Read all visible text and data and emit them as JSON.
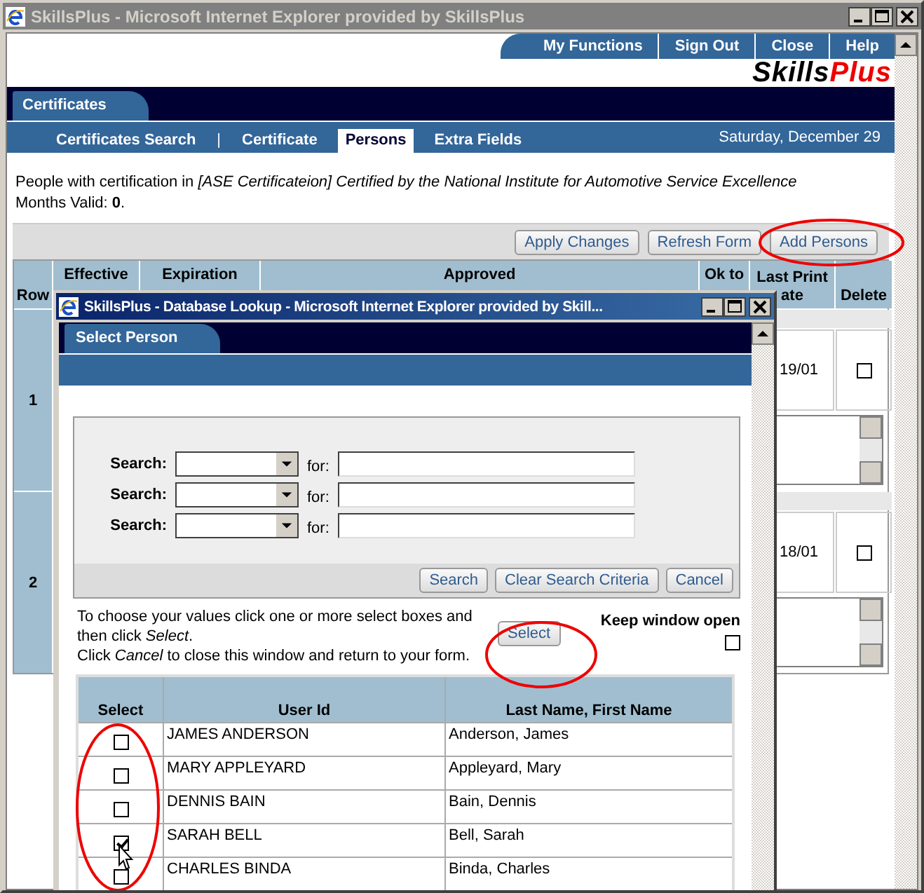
{
  "window": {
    "title": "SkillsPlus - Microsoft Internet Explorer provided by SkillsPlus",
    "active": false
  },
  "top_nav": [
    "My Functions",
    "Sign Out",
    "Close",
    "Help"
  ],
  "logo": {
    "part_1": "Skills",
    "part_2": "Plus"
  },
  "main_tab": "Certificates",
  "sub_nav": [
    {
      "kind": "tab",
      "label": "Certificates Search",
      "selected": false
    },
    {
      "kind": "separator",
      "label": "|"
    },
    {
      "kind": "tab",
      "label": "Certificate",
      "selected": false
    },
    {
      "kind": "tab",
      "label": "Persons",
      "selected": true
    },
    {
      "kind": "tab",
      "label": "Extra Fields",
      "selected": false
    }
  ],
  "date": "Saturday, December 29",
  "intro": "People with certification in *[ASE Certificateion] Certified by the National Institute for Automotive Service Excellence*  Months Valid: **0**.",
  "toolbar_buttons": [
    "Apply Changes",
    "Refresh Form",
    "Add Persons"
  ],
  "table": {
    "columns": [
      [
        "Row"
      ],
      [
        "Effective"
      ],
      [
        "Expiration"
      ],
      [
        "Approved"
      ],
      [
        "Ok to"
      ],
      [
        "Last Print",
        "ate"
      ],
      [
        "Delete"
      ]
    ],
    "rows": [
      {
        "row": "1",
        "last_print": "19/01",
        "delete": false
      },
      {
        "row": "2",
        "last_print": "18/01",
        "delete": false
      }
    ]
  },
  "popup": {
    "title": "SkillsPlus - Database Lookup - Microsoft Internet Explorer provided by Skill...",
    "active": true,
    "tab": "Select Person",
    "search_rows": [
      {
        "label": "Search:",
        "connector": "for:"
      },
      {
        "label": "Search:",
        "connector": "for:"
      },
      {
        "label": "Search:",
        "connector": "for:"
      }
    ],
    "search_buttons": [
      "Search",
      "Clear Search Criteria",
      "Cancel"
    ],
    "instructions": [
      "To choose your values click one or more select boxes and then click *Select*.",
      "Click *Cancel* to close this window and return to your form."
    ],
    "select_button": "Select",
    "keep_open": {
      "label": "Keep window open",
      "checked": false
    },
    "results": {
      "columns": [
        "Select",
        "User Id",
        "Last Name, First Name"
      ],
      "rows": [
        {
          "user_id": "JAMES ANDERSON",
          "name": "Anderson, James",
          "checked": false
        },
        {
          "user_id": "MARY APPLEYARD",
          "name": "Appleyard, Mary",
          "checked": false
        },
        {
          "user_id": "DENNIS BAIN",
          "name": "Bain, Dennis",
          "checked": false
        },
        {
          "user_id": "SARAH BELL",
          "name": "Bell, Sarah",
          "checked": true
        },
        {
          "user_id": "CHARLES BINDA",
          "name": "Binda, Charles",
          "checked": false
        }
      ]
    }
  }
}
